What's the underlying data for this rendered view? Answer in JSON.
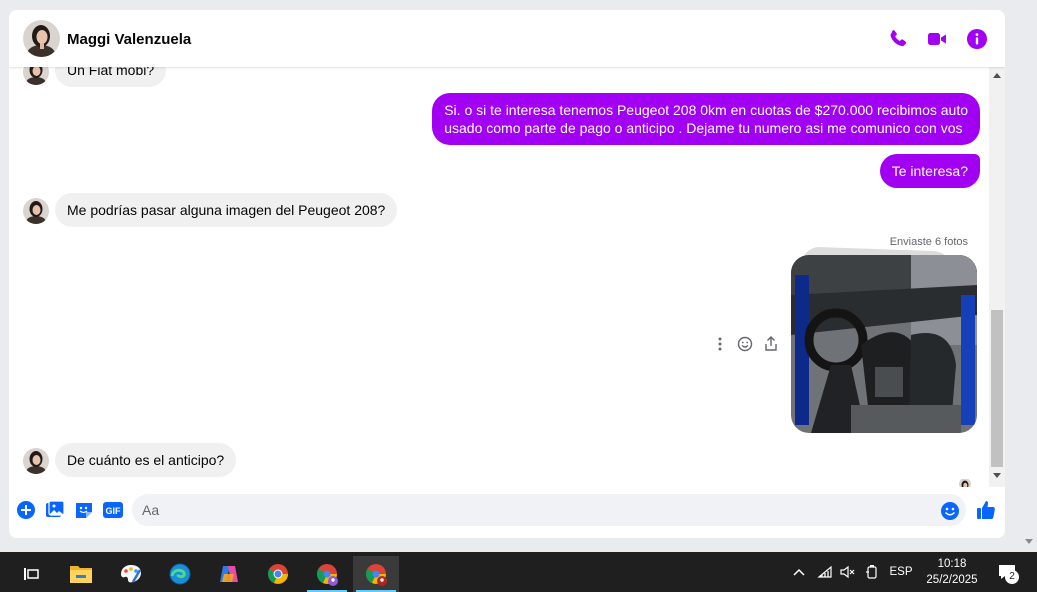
{
  "header": {
    "contact_name": "Maggi Valenzuela",
    "icons": [
      "phone-icon",
      "video-camera-icon",
      "info-icon"
    ]
  },
  "conversation": {
    "messages": [
      {
        "direction": "incoming",
        "text": "Un Fiat mobi?"
      },
      {
        "direction": "outgoing",
        "text": "Si. o si te interesa tenemos Peugeot 208 0km en cuotas de $270.000 recibimos auto usado como parte de pago o anticipo . Dejame tu numero asi me comunico con vos",
        "lines": [
          "Si. o si te interesa tenemos Peugeot 208 0km en cuotas de $270.000 recibimos auto",
          "usado como parte de pago o anticipo . Dejame tu numero asi me comunico con vos"
        ]
      },
      {
        "direction": "outgoing",
        "text": "Te interesa?"
      },
      {
        "direction": "incoming",
        "text": "Me podrías pasar alguna imagen del Peugeot 208?"
      },
      {
        "direction": "outgoing",
        "type": "photos",
        "label": "Enviaste 6 fotos"
      },
      {
        "direction": "incoming",
        "text": "De cuánto es el anticipo?"
      }
    ],
    "message_actions": [
      "more-options-icon",
      "react-icon",
      "forward-icon"
    ]
  },
  "composer": {
    "placeholder": "Aa",
    "icons": [
      "plus-icon",
      "image-icon",
      "sticker-icon",
      "gif-icon",
      "emoji-icon",
      "like-icon"
    ],
    "gif_label": "GIF"
  },
  "colors": {
    "accent": "#a100f2",
    "composer_blue": "#0866ff",
    "incoming_bubble": "#f0f0f0",
    "taskbar": "#1f1f1f"
  },
  "taskbar": {
    "apps": [
      "task-view-icon",
      "file-explorer-icon",
      "paint-icon",
      "edge-icon",
      "copilot-icon",
      "chrome-icon",
      "chrome-profile-icon",
      "chrome-profile-active-icon"
    ],
    "language": "ESP",
    "time": "10:18",
    "date": "25/2/2025",
    "notification_count": "2"
  }
}
